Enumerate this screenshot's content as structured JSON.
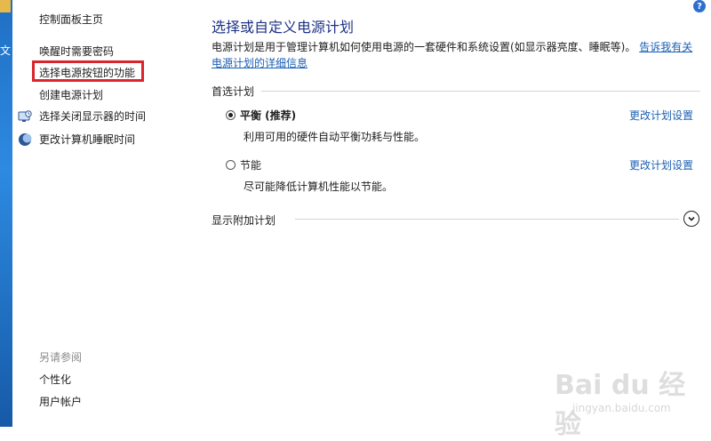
{
  "desktop": {
    "edge_glyph": "文"
  },
  "sidebar": {
    "home": "控制面板主页",
    "items": [
      {
        "label": "唤醒时需要密码"
      },
      {
        "label": "选择电源按钮的功能",
        "highlighted": true
      },
      {
        "label": "创建电源计划"
      },
      {
        "label": "选择关闭显示器的时间",
        "icon": "monitor-icon"
      },
      {
        "label": "更改计算机睡眠时间",
        "icon": "moon-icon"
      }
    ],
    "see_also_heading": "另请参阅",
    "see_also": [
      {
        "label": "个性化"
      },
      {
        "label": "用户帐户"
      }
    ]
  },
  "main": {
    "title": "选择或自定义电源计划",
    "description": "电源计划是用于管理计算机如何使用电源的一套硬件和系统设置(如显示器亮度、睡眠等)。",
    "description_link": "告诉我有关电源计划的详细信息",
    "preferred_heading": "首选计划",
    "plans": [
      {
        "name": "平衡 (推荐)",
        "description": "利用可用的硬件自动平衡功耗与性能。",
        "change_label": "更改计划设置",
        "selected": true
      },
      {
        "name": "节能",
        "description": "尽可能降低计算机性能以节能。",
        "change_label": "更改计划设置",
        "selected": false
      }
    ],
    "additional_heading": "显示附加计划"
  },
  "help": {
    "label": "?"
  },
  "watermark": {
    "logo_text": "Bai du 经验",
    "url": "jingyan.baidu.com"
  },
  "colors": {
    "accent_link": "#1a5fb4",
    "title": "#1e3287",
    "highlight_border": "#d9262e"
  }
}
